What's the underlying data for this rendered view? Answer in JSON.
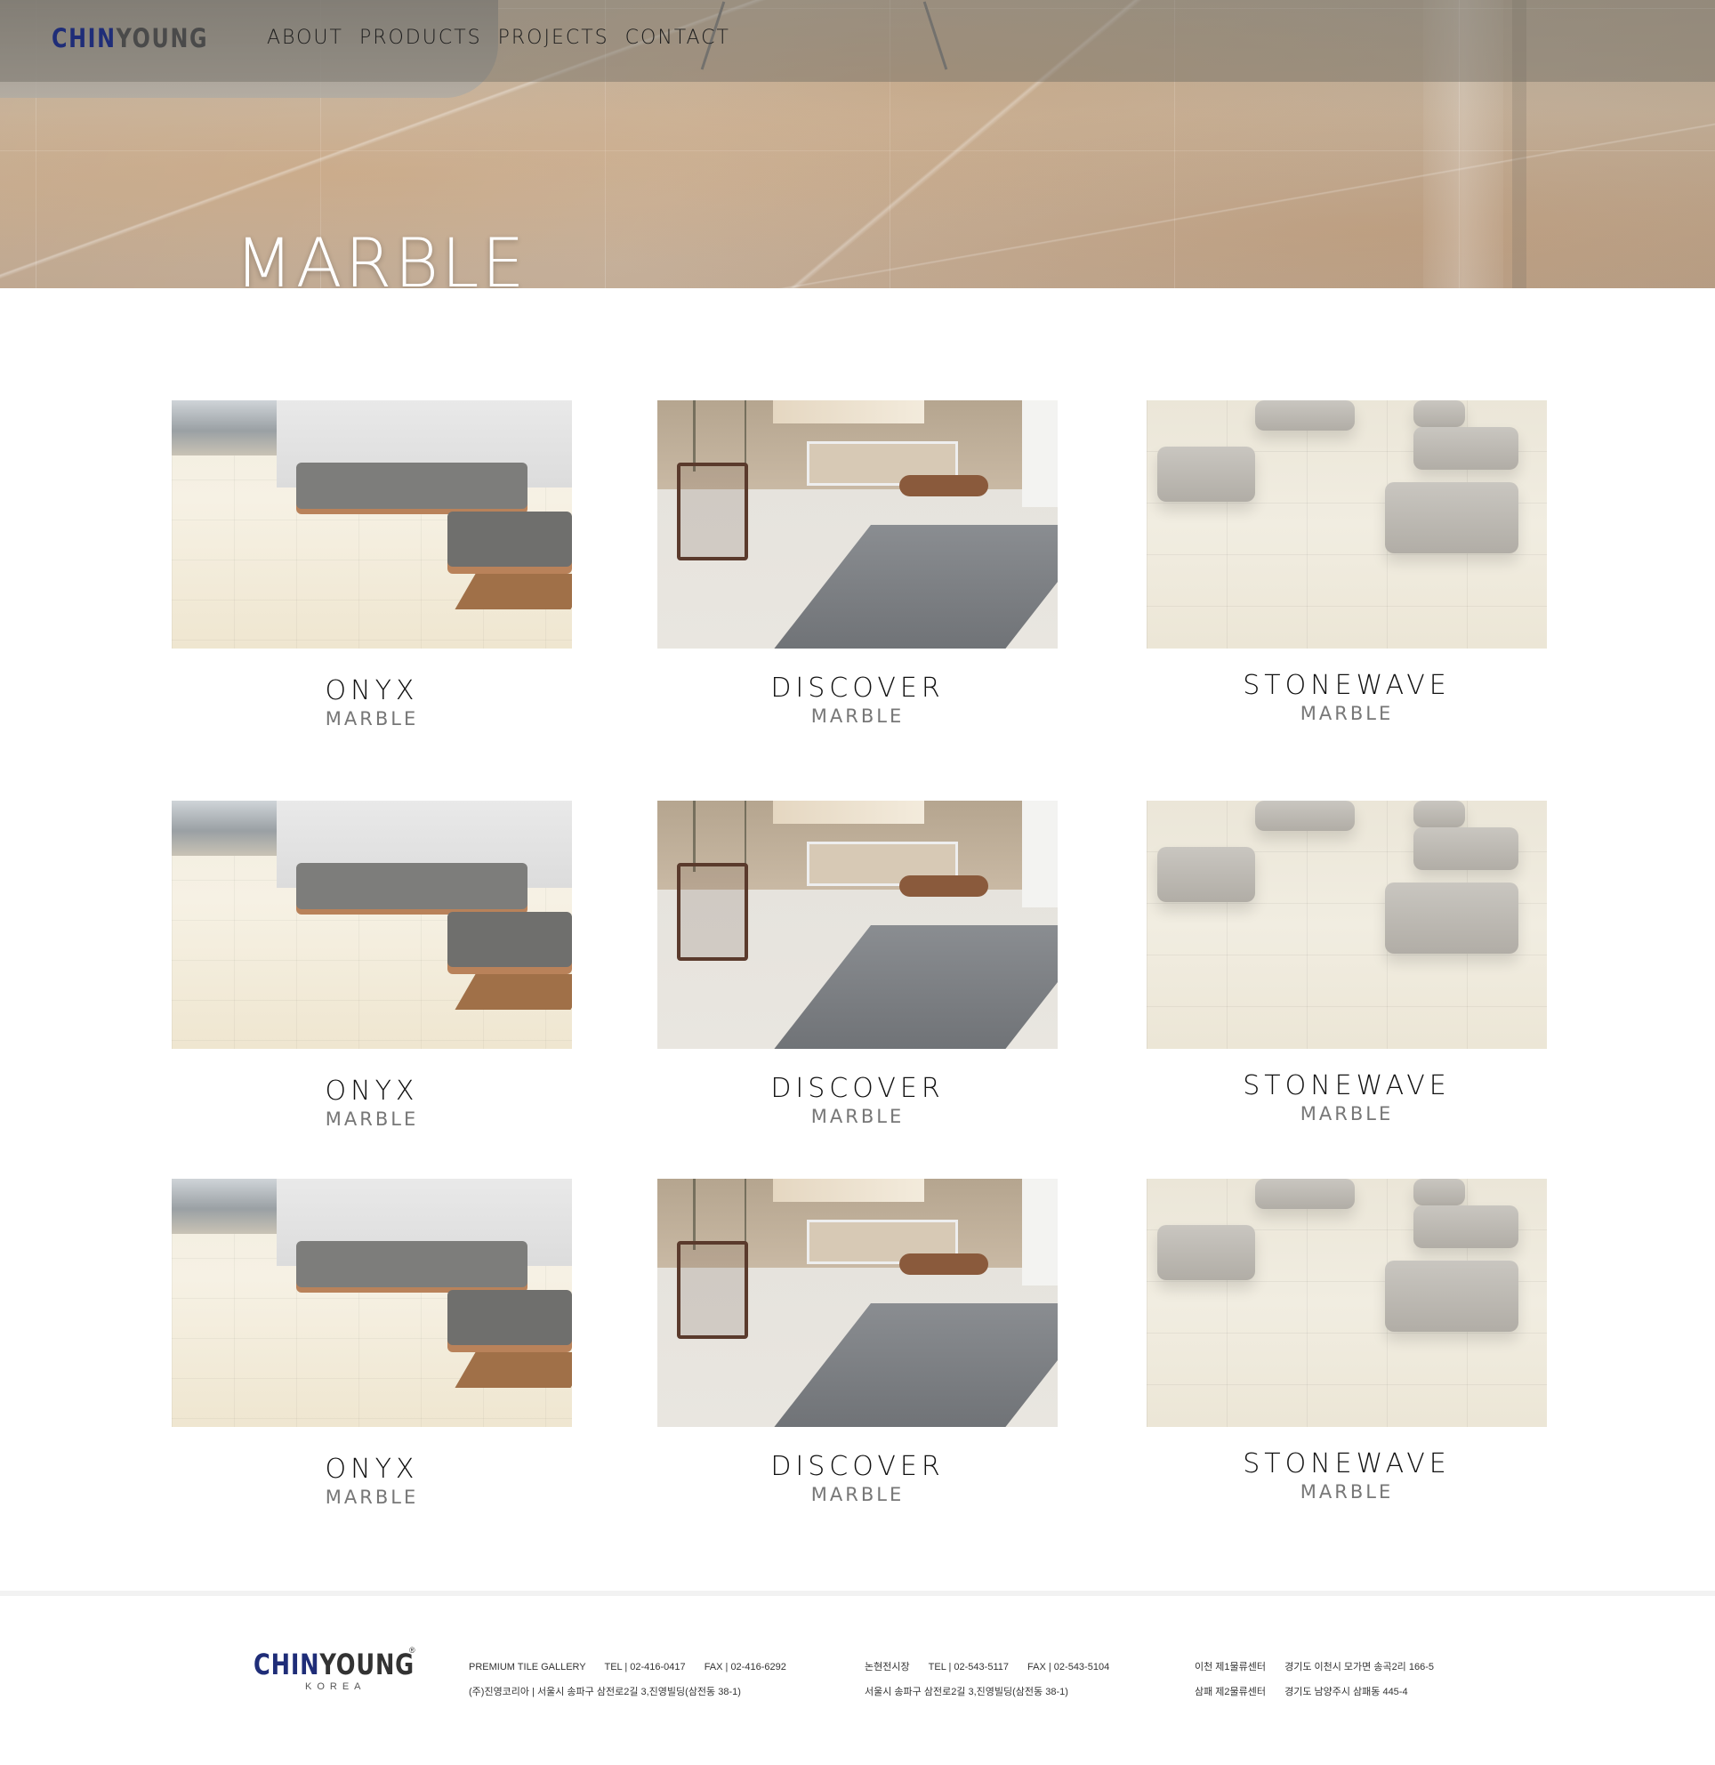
{
  "header": {
    "logo": {
      "part1": "CHIN",
      "part2": "YOUNG"
    },
    "nav": [
      "ABOUT",
      "PRODUCTS",
      "PROJECTS",
      "CONTACT"
    ]
  },
  "hero": {
    "title": "MARBLE"
  },
  "products": [
    {
      "name": "ONYX",
      "category": "MARBLE",
      "scene": "onyx"
    },
    {
      "name": "DISCOVER",
      "category": "MARBLE",
      "scene": "discover"
    },
    {
      "name": "STONEWAVE",
      "category": "MARBLE",
      "scene": "stonewave"
    },
    {
      "name": "ONYX",
      "category": "MARBLE",
      "scene": "onyx"
    },
    {
      "name": "DISCOVER",
      "category": "MARBLE",
      "scene": "discover"
    },
    {
      "name": "STONEWAVE",
      "category": "MARBLE",
      "scene": "stonewave"
    },
    {
      "name": "ONYX",
      "category": "MARBLE",
      "scene": "onyx"
    },
    {
      "name": "DISCOVER",
      "category": "MARBLE",
      "scene": "discover"
    },
    {
      "name": "STONEWAVE",
      "category": "MARBLE",
      "scene": "stonewave"
    }
  ],
  "footer": {
    "logo": {
      "part1": "CHIN",
      "part2": "YOUNG",
      "mark": "®",
      "sub": "KOREA"
    },
    "col1": {
      "line1_a": "PREMIUM TILE GALLERY",
      "line1_b": "TEL | 02-416-0417",
      "line1_c": "FAX | 02-416-6292",
      "line2": "(주)진영코리아 | 서울시 송파구 삼전로2길 3,진영빌딩(삼전동 38-1)"
    },
    "col2": {
      "line1_a": "논현전시장",
      "line1_b": "TEL | 02-543-5117",
      "line1_c": "FAX | 02-543-5104",
      "line2": "서울시 송파구 삼전로2길 3,진영빌딩(삼전동 38-1)"
    },
    "col3": {
      "line1_a": "이천 제1물류센터",
      "line1_b": "경기도 이천시 모가면 송곡2리 166-5",
      "line2_a": "삼패 제2물류센터",
      "line2_b": "경기도 남양주시 삼패동 445-4"
    }
  },
  "colors": {
    "brand_blue": "#1f2d78",
    "text_dark": "#111111",
    "text_grey": "#777777"
  },
  "icons": []
}
